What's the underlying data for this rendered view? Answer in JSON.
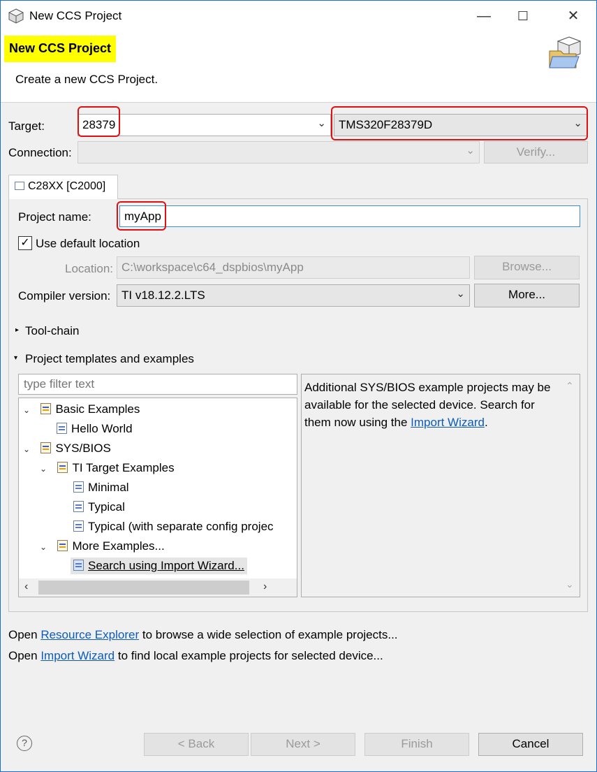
{
  "window": {
    "title": "New CCS Project"
  },
  "banner": {
    "title": "New CCS Project",
    "subtitle": "Create a new CCS Project."
  },
  "target": {
    "label": "Target:",
    "family_value": "28379",
    "device_value": "TMS320F28379D"
  },
  "connection": {
    "label": "Connection:",
    "value": "",
    "verify_label": "Verify..."
  },
  "tab": {
    "label": "C28XX [C2000]"
  },
  "project": {
    "name_label": "Project name:",
    "name_value": "myApp",
    "use_default_label": "Use default location",
    "location_label": "Location:",
    "location_value": "C:\\workspace\\c64_dspbios\\myApp",
    "browse_label": "Browse...",
    "compiler_label": "Compiler version:",
    "compiler_value": "TI v18.12.2.LTS",
    "more_label": "More..."
  },
  "sections": {
    "toolchain": "Tool-chain",
    "templates": "Project templates and examples"
  },
  "filter": {
    "placeholder": "type filter text"
  },
  "tree": [
    {
      "label": "Basic Examples"
    },
    {
      "label": "Hello World"
    },
    {
      "label": "SYS/BIOS"
    },
    {
      "label": "TI Target Examples"
    },
    {
      "label": "Minimal"
    },
    {
      "label": "Typical"
    },
    {
      "label": "Typical (with separate config projec"
    },
    {
      "label": "More Examples..."
    },
    {
      "label": "Search using Import Wizard..."
    }
  ],
  "description": {
    "text": "Additional SYS/BIOS example projects may be available for the selected device. Search for them now using the",
    "link": "Import Wizard",
    "suffix": "."
  },
  "footer": {
    "line1_pre": "Open",
    "line1_link": "Resource Explorer",
    "line1_post": "to browse a wide selection of example projects...",
    "line2_pre": "Open",
    "line2_link": "Import Wizard",
    "line2_post": "to find local example projects for selected device..."
  },
  "buttons": {
    "back": "< Back",
    "next": "Next >",
    "finish": "Finish",
    "cancel": "Cancel",
    "help": "?"
  },
  "colors": {
    "highlight": "#ffff00",
    "annotation": "#e01010",
    "link": "#0d5bb8"
  },
  "icons": [
    "ccs-app-icon",
    "minimize-icon",
    "maximize-icon",
    "close-icon",
    "project-wizard-icon",
    "chevron-down-icon",
    "folder-icon",
    "help-icon"
  ]
}
